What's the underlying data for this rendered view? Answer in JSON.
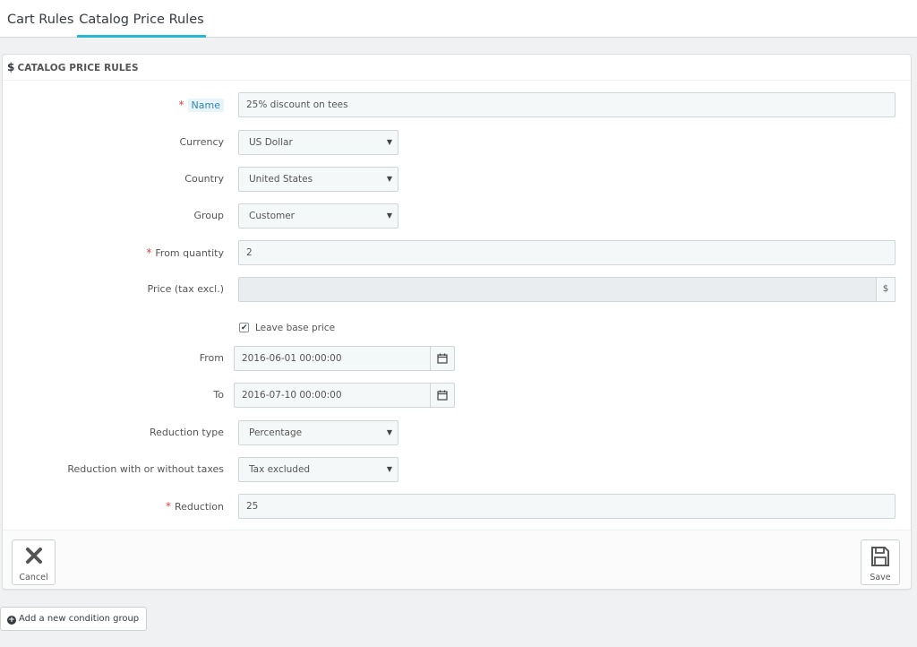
{
  "tabs": {
    "cart_rules": "Cart Rules",
    "catalog_price_rules": "Catalog Price Rules"
  },
  "panel": {
    "title": "CATALOG PRICE RULES",
    "title_icon": "$"
  },
  "form": {
    "name_label": "Name",
    "name_value": "25% discount on tees",
    "currency_label": "Currency",
    "currency_value": "US Dollar",
    "country_label": "Country",
    "country_value": "United States",
    "group_label": "Group",
    "group_value": "Customer",
    "from_quantity_label": "From quantity",
    "from_quantity_value": "2",
    "price_label": "Price (tax excl.)",
    "price_value": "",
    "price_addon": "$",
    "leave_base_price_label": "Leave base price",
    "leave_base_price_checked": true,
    "from_label": "From",
    "from_value": "2016-06-01 00:00:00",
    "to_label": "To",
    "to_value": "2016-07-10 00:00:00",
    "reduction_type_label": "Reduction type",
    "reduction_type_value": "Percentage",
    "reduction_taxes_label": "Reduction with or without taxes",
    "reduction_taxes_value": "Tax excluded",
    "reduction_label": "Reduction",
    "reduction_value": "25",
    "required_marker": "*"
  },
  "footer": {
    "cancel_label": "Cancel",
    "save_label": "Save"
  },
  "add_condition_group_label": "Add a new condition group",
  "colors": {
    "accent": "#25b9d7",
    "required": "#e3413f",
    "label_highlight_bg": "#e8f4f9"
  }
}
